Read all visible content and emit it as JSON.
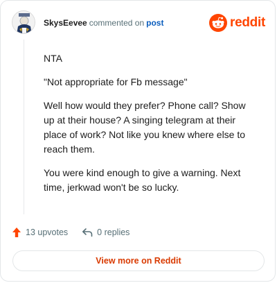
{
  "header": {
    "username": "SkysEevee",
    "action_text": "commented on",
    "post_link": "post",
    "brand_name": "reddit"
  },
  "comment": {
    "paragraphs": [
      "NTA",
      "\"Not appropriate for Fb message\"",
      "Well how would they prefer? Phone call? Show up at their house? A singing telegram at their place of work? Not like you knew where else to reach them.",
      "You were kind enough to give a warning. Next time, jerkwad won't be so lucky."
    ]
  },
  "footer": {
    "upvotes": "13 upvotes",
    "replies": "0 replies",
    "view_more": "View more on Reddit"
  },
  "colors": {
    "brand": "#ff4500",
    "link": "#0a5dbd",
    "muted": "#576f76",
    "button_text": "#d93a00"
  },
  "icons": {
    "avatar": "user-avatar",
    "logo": "reddit-snoo-icon",
    "upvote": "upvote-arrow-icon",
    "reply": "reply-arrow-icon"
  }
}
